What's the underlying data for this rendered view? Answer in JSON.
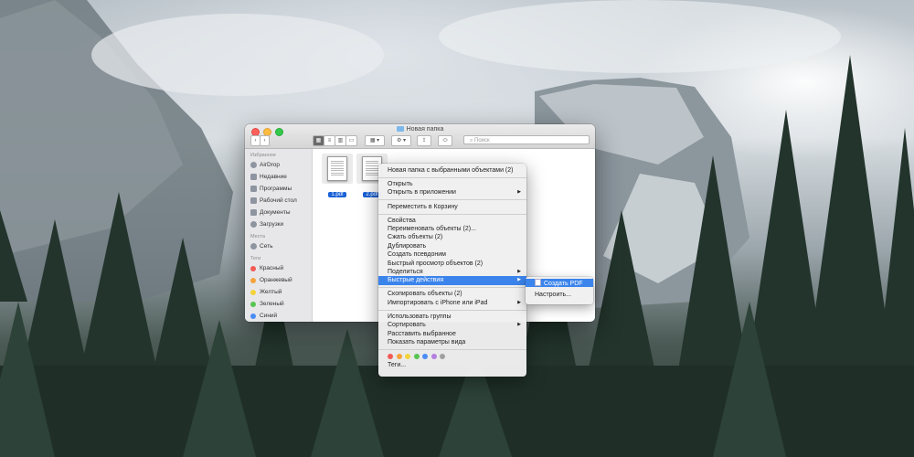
{
  "window": {
    "title": "Новая папка",
    "search_placeholder": "Поиск"
  },
  "sidebar": {
    "favorites_header": "Избранное",
    "favorites": [
      {
        "label": "AirDrop"
      },
      {
        "label": "Недавние"
      },
      {
        "label": "Программы"
      },
      {
        "label": "Рабочий стол"
      },
      {
        "label": "Документы"
      },
      {
        "label": "Загрузки"
      }
    ],
    "places_header": "Места",
    "places": [
      {
        "label": "Сеть"
      }
    ],
    "tags_header": "Теги",
    "tags": [
      {
        "label": "Красный",
        "color": "#f25a55"
      },
      {
        "label": "Оранжевый",
        "color": "#f5a33a"
      },
      {
        "label": "Желтый",
        "color": "#f4d33a"
      },
      {
        "label": "Зеленый",
        "color": "#58c453"
      },
      {
        "label": "Синий",
        "color": "#4c8cf5"
      }
    ]
  },
  "files": [
    {
      "name": "1.pdf"
    },
    {
      "name": "2.pdf"
    }
  ],
  "context_menu": {
    "items": [
      "Новая папка с выбранными объектами (2)",
      "Открыть",
      "Открыть в приложении",
      "Переместить в Корзину",
      "Свойства",
      "Переименовать объекты (2)...",
      "Сжать объекты (2)",
      "Дублировать",
      "Создать псевдоним",
      "Быстрый просмотр объектов (2)",
      "Поделиться",
      "Быстрые действия",
      "Скопировать объекты (2)",
      "Импортировать с iPhone или iPad",
      "Использовать группы",
      "Сортировать",
      "Расставить выбранное",
      "Показать параметры вида",
      "Теги..."
    ],
    "tag_colors": [
      "#f25a55",
      "#f5a33a",
      "#f4d33a",
      "#58c453",
      "#4c8cf5",
      "#b47fe0",
      "#a0a0a0"
    ]
  },
  "submenu": {
    "items": [
      "Создать PDF",
      "Настроить..."
    ]
  },
  "accent_color": "#3b84ec"
}
